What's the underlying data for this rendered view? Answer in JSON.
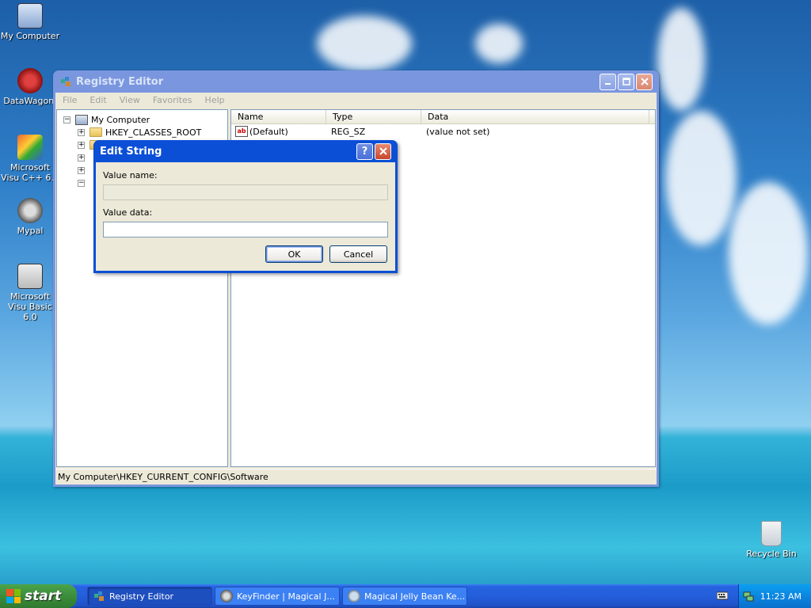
{
  "desktop": {
    "icons": [
      {
        "label": "My Computer",
        "icon": "my-computer-icon"
      },
      {
        "label": "DataWagon.",
        "icon": "datawagon-icon"
      },
      {
        "label": "Microsoft Visu C++ 6.0",
        "icon": "visual-cpp-icon"
      },
      {
        "label": "Mypal",
        "icon": "mypal-icon"
      },
      {
        "label": "Microsoft Visu Basic 6.0",
        "icon": "visual-basic-icon"
      },
      {
        "label": "Recycle Bin",
        "icon": "recycle-bin-icon"
      }
    ]
  },
  "regedit": {
    "title": "Registry Editor",
    "menu": [
      "File",
      "Edit",
      "View",
      "Favorites",
      "Help"
    ],
    "tree": {
      "root": "My Computer",
      "items": [
        "HKEY_CLASSES_ROOT"
      ]
    },
    "columns": [
      "Name",
      "Type",
      "Data"
    ],
    "rows": [
      {
        "name": "(Default)",
        "type": "REG_SZ",
        "data": "(value not set)"
      }
    ],
    "status": "My Computer\\HKEY_CURRENT_CONFIG\\Software"
  },
  "dialog": {
    "title": "Edit String",
    "value_name_label": "Value name:",
    "value_name": "",
    "value_data_label": "Value data:",
    "value_data": "",
    "ok": "OK",
    "cancel": "Cancel"
  },
  "taskbar": {
    "start": "start",
    "tasks": [
      {
        "label": "Registry Editor",
        "active": true
      },
      {
        "label": "KeyFinder | Magical J...",
        "active": false
      },
      {
        "label": "Magical Jelly Bean Ke...",
        "active": false
      }
    ],
    "clock": "11:23 AM"
  },
  "colors": {
    "xp_title_blue": "#0a4fd6",
    "start_green": "#3c8d3c",
    "taskbar_blue": "#245edb"
  }
}
